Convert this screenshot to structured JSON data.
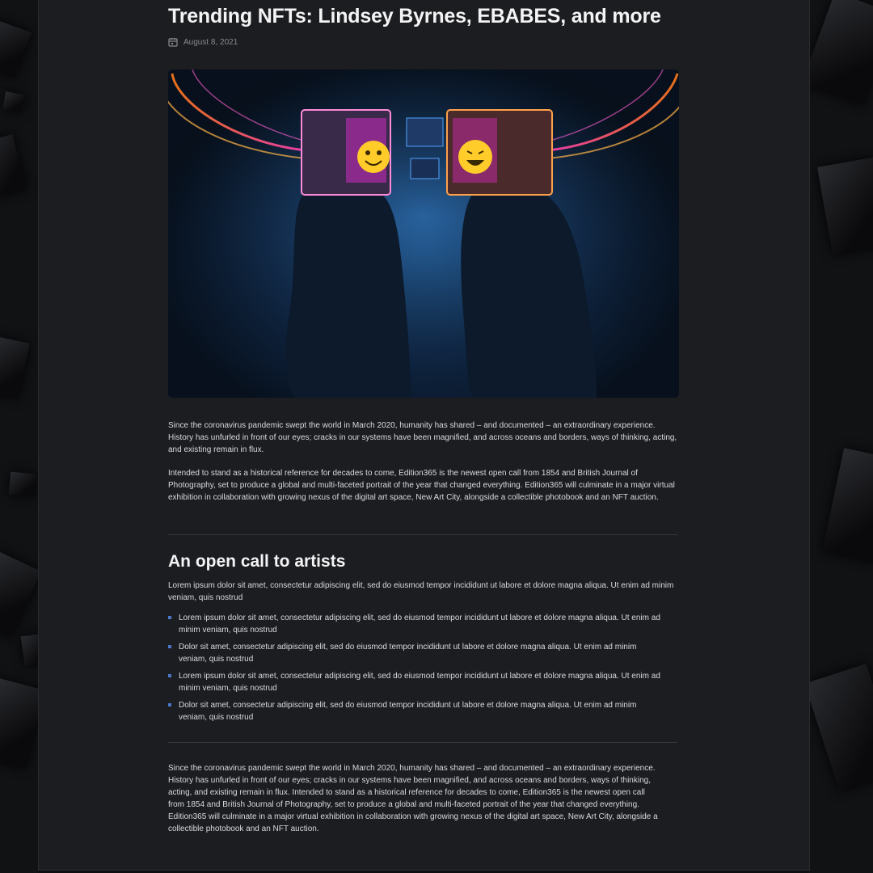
{
  "article": {
    "title": "Trending NFTs: Lindsey Byrnes, EBABES, and more",
    "date": "August 8, 2021",
    "hero_image_alt": "Two figures with glowing emoji cube heads",
    "paragraphs": [
      "Since the coronavirus pandemic swept the world in March 2020, humanity has shared – and documented – an extraordinary experience. History has unfurled in front of our eyes; cracks in our systems have been magnified, and across oceans and borders, ways of thinking, acting, and existing remain in flux.",
      "Intended to stand as a historical reference for decades to come, Edition365 is the newest open call from 1854 and British Journal of Photography, set to produce a global and multi-faceted portrait of the year that changed everything. Edition365 will culminate in a major virtual exhibition in collaboration with growing nexus of the digital art space, New Art City, alongside a collectible photobook and an NFT auction."
    ],
    "section_heading": "An open call to artists",
    "section_intro": "Lorem ipsum dolor sit amet, consectetur adipiscing elit, sed do eiusmod tempor incididunt ut labore et dolore magna aliqua. Ut enim ad minim veniam, quis nostrud",
    "list_items": [
      "Lorem ipsum dolor sit amet, consectetur adipiscing elit, sed do eiusmod tempor incididunt ut labore et dolore magna aliqua. Ut enim ad minim veniam, quis nostrud",
      "Dolor sit amet, consectetur adipiscing elit, sed do eiusmod tempor incididunt ut labore et dolore magna aliqua. Ut enim ad minim veniam, quis nostrud",
      "Lorem ipsum dolor sit amet, consectetur adipiscing elit, sed do eiusmod tempor incididunt ut labore et dolore magna aliqua. Ut enim ad minim veniam, quis nostrud",
      "Dolor sit amet, consectetur adipiscing elit, sed do eiusmod tempor incididunt ut labore et dolore magna aliqua. Ut enim ad minim veniam, quis nostrud"
    ],
    "closing_paragraph": "Since the coronavirus pandemic swept the world in March 2020, humanity has shared – and documented – an extraordinary experience. History has unfurled in front of our eyes; cracks in our systems have been magnified, and across oceans and borders, ways of thinking, acting, and existing remain in flux. Intended to stand as a historical reference for decades to come, Edition365 is the newest open call from 1854 and British Journal of Photography, set to produce a global and multi-faceted portrait of the year that changed everything. Edition365 will culminate in a major virtual exhibition in collaboration with growing nexus of the digital art space, New Art City, alongside a collectible photobook and an NFT auction."
  },
  "icons": {
    "date": "calendar-icon",
    "list_bullet": "square-bullet-icon"
  },
  "colors": {
    "background": "#0d0e10",
    "panel": "#1c1d21",
    "text": "#d9dadd",
    "heading": "#f4f4f5",
    "muted": "#8a8b90",
    "bullet": "#4a78c9"
  }
}
